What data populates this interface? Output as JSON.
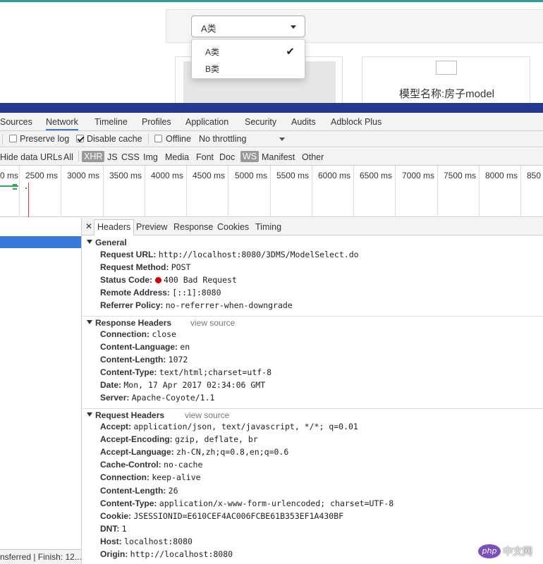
{
  "page": {
    "select_value": "A类",
    "dropdown_options": [
      {
        "label": "A类",
        "selected": true
      },
      {
        "label": "B类",
        "selected": false
      }
    ],
    "broken_image_text": "",
    "model_name": "模型名称:房子model"
  },
  "devtools": {
    "tabs": [
      "Sources",
      "Network",
      "Timeline",
      "Profiles",
      "Application",
      "Security",
      "Audits",
      "Adblock Plus"
    ],
    "active_tab": "Network",
    "toolbar": {
      "preserve_log": "Preserve log",
      "disable_cache": "Disable cache",
      "offline": "Offline",
      "throttling": "No throttling"
    },
    "filters": {
      "hide_data_urls": "Hide data URLs",
      "types": [
        "All",
        "XHR",
        "JS",
        "CSS",
        "Img",
        "Media",
        "Font",
        "Doc",
        "WS",
        "Manifest",
        "Other"
      ],
      "selected": [
        "XHR",
        "WS"
      ]
    },
    "timeline_ticks": [
      "0 ms",
      "2500 ms",
      "3000 ms",
      "3500 ms",
      "4000 ms",
      "4500 ms",
      "5000 ms",
      "5500 ms",
      "6000 ms",
      "6500 ms",
      "7000 ms",
      "7500 ms",
      "8000 ms",
      "850"
    ],
    "detail_tabs": [
      "Headers",
      "Preview",
      "Response",
      "Cookies",
      "Timing"
    ],
    "active_detail_tab": "Headers",
    "general": {
      "title": "General",
      "rows": [
        {
          "k": "Request URL:",
          "v": "http://localhost:8080/3DMS/ModelSelect.do"
        },
        {
          "k": "Request Method:",
          "v": "POST"
        },
        {
          "k": "Status Code:",
          "v": "400 Bad Request"
        },
        {
          "k": "Remote Address:",
          "v": "[::1]:8080"
        },
        {
          "k": "Referrer Policy:",
          "v": "no-referrer-when-downgrade"
        }
      ]
    },
    "response_headers": {
      "title": "Response Headers",
      "view_source": "view source",
      "rows": [
        {
          "k": "Connection:",
          "v": "close"
        },
        {
          "k": "Content-Language:",
          "v": "en"
        },
        {
          "k": "Content-Length:",
          "v": "1072"
        },
        {
          "k": "Content-Type:",
          "v": "text/html;charset=utf-8"
        },
        {
          "k": "Date:",
          "v": "Mon, 17 Apr 2017 02:34:06 GMT"
        },
        {
          "k": "Server:",
          "v": "Apache-Coyote/1.1"
        }
      ]
    },
    "request_headers": {
      "title": "Request Headers",
      "view_source": "view source",
      "rows": [
        {
          "k": "Accept:",
          "v": "application/json, text/javascript, */*; q=0.01"
        },
        {
          "k": "Accept-Encoding:",
          "v": "gzip, deflate, br"
        },
        {
          "k": "Accept-Language:",
          "v": "zh-CN,zh;q=0.8,en;q=0.6"
        },
        {
          "k": "Cache-Control:",
          "v": "no-cache"
        },
        {
          "k": "Connection:",
          "v": "keep-alive"
        },
        {
          "k": "Content-Length:",
          "v": "26"
        },
        {
          "k": "Content-Type:",
          "v": "application/x-www-form-urlencoded; charset=UTF-8"
        },
        {
          "k": "Cookie:",
          "v": "JSESSIONID=E610CEF4AC006FCBE61B353EF1A430BF"
        },
        {
          "k": "DNT:",
          "v": "1"
        },
        {
          "k": "Host:",
          "v": "localhost:8080"
        },
        {
          "k": "Origin:",
          "v": "http://localhost:8080"
        }
      ]
    },
    "statusbar": "nsferred | Finish: 12..."
  },
  "watermark": {
    "logo": "php",
    "text": "中文网"
  },
  "colors": {
    "status_error": "#d50000",
    "accent": "#3879d9",
    "devtools_bar": "#253a8e"
  }
}
